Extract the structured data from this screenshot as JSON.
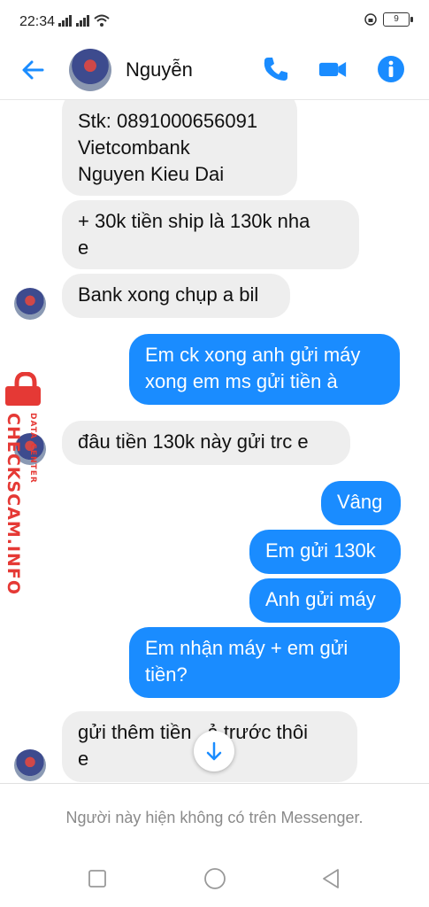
{
  "status_bar": {
    "time": "22:34",
    "battery": "9"
  },
  "header": {
    "contact_name": "Nguyễn",
    "accent_color": "#1a8cff"
  },
  "messages": [
    {
      "side": "in",
      "text_lines": [
        "Stk: 0891000656091",
        "Vietcombank",
        "Nguyen Kieu Dai"
      ]
    },
    {
      "side": "in",
      "text_lines": [
        "+ 30k tiền ship là 130k nha",
        "e"
      ]
    },
    {
      "side": "in",
      "text_lines": [
        "Bank xong chụp a bil"
      ]
    },
    {
      "side": "out",
      "text_lines": [
        "Em ck xong anh gửi máy",
        "xong em ms gửi tiền à"
      ]
    },
    {
      "side": "in",
      "text_lines": [
        "đâu tiền 130k này gửi trc e"
      ]
    },
    {
      "side": "out",
      "text_lines": [
        "Vâng"
      ]
    },
    {
      "side": "out",
      "text_lines": [
        "Em gửi 130k"
      ]
    },
    {
      "side": "out",
      "text_lines": [
        "Anh gửi máy"
      ]
    },
    {
      "side": "out",
      "text_lines": [
        "Em nhận máy + em gửi",
        "tiền?"
      ]
    },
    {
      "side": "in",
      "text_lines": [
        "gửi thêm tiền",
        "e"
      ],
      "line1_tail": "ả trước thôi"
    }
  ],
  "watermark": {
    "brand": "CHECKSCAM.INFO",
    "subtitle": "DATA CENTER"
  },
  "footer": {
    "notice": "Người này hiện không có trên Messenger."
  }
}
